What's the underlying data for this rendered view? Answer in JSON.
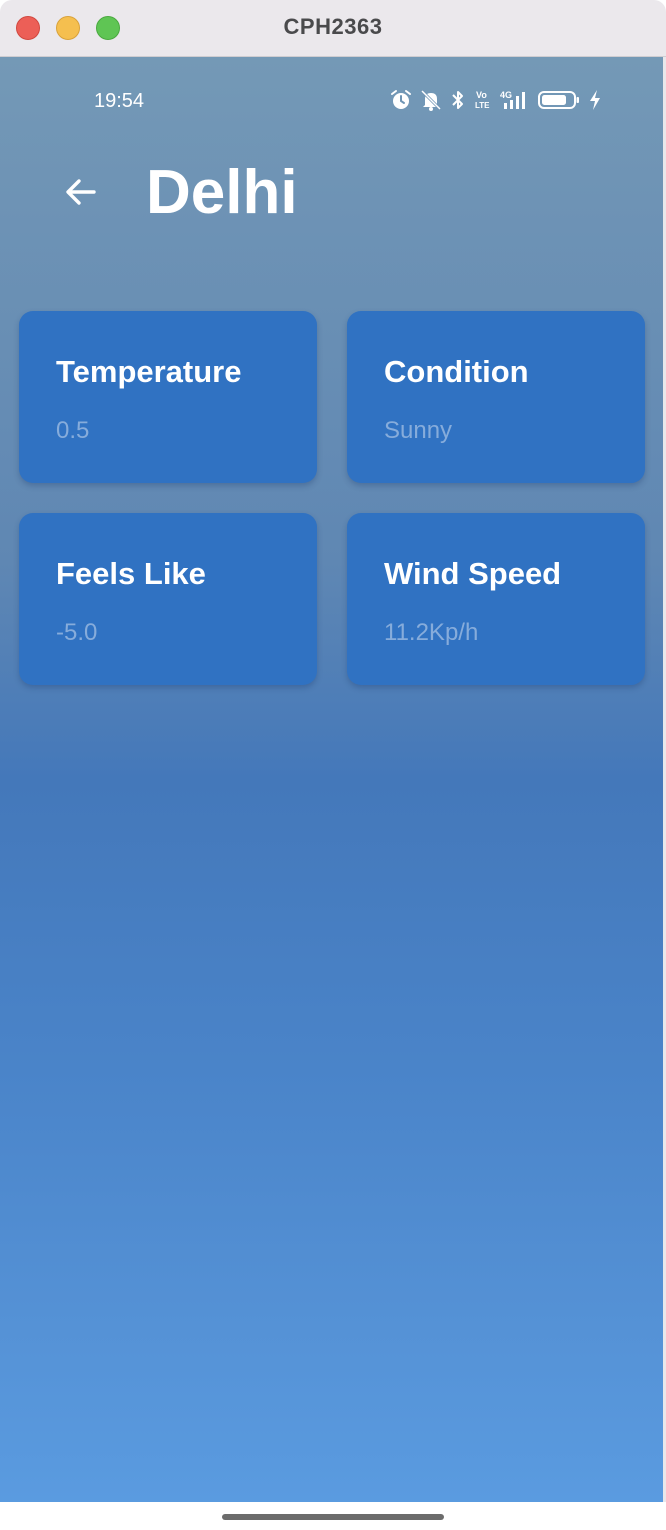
{
  "window": {
    "title": "CPH2363"
  },
  "status_bar": {
    "time": "19:54",
    "icons": [
      "alarm-icon",
      "bell-muted-icon",
      "bluetooth-icon",
      "volte-icon",
      "4g-signal-icon",
      "battery-icon",
      "charging-bolt-icon"
    ],
    "volte_label": "Vo\nLTE",
    "network_label": "4G"
  },
  "header": {
    "back_icon": "arrow-left-icon",
    "city": "Delhi"
  },
  "cards": [
    {
      "title": "Temperature",
      "value": "0.5"
    },
    {
      "title": "Condition",
      "value": "Sunny"
    },
    {
      "title": "Feels Like",
      "value": "-5.0"
    },
    {
      "title": "Wind Speed",
      "value": "11.2Kp/h"
    }
  ],
  "colors": {
    "card_background": "#3072c2",
    "card_value_text": "#86acdb",
    "background_top": "#7499b6",
    "background_bottom": "#5a9be0"
  }
}
